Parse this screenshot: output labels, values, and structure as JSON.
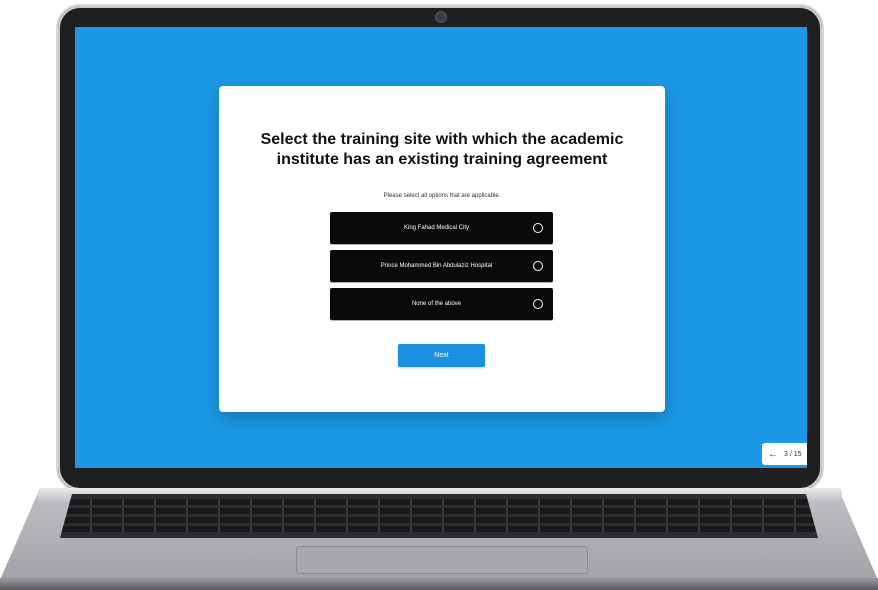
{
  "question": {
    "title": "Select the training site with which the academic institute has an existing training agreement",
    "instruction": "Please select all options that are applicable."
  },
  "options": [
    {
      "label": "King Fahad Medical City",
      "selected": false
    },
    {
      "label": "Prince Mohammed Bin Abdulaziz Hospital",
      "selected": false
    },
    {
      "label": "None of the above",
      "selected": false
    }
  ],
  "next_button": {
    "label": "Next"
  },
  "pager": {
    "arrow": "←",
    "text": "3 / 15"
  },
  "colors": {
    "screen_background": "#1b99e6",
    "option_background": "#0a0a0a",
    "button_background": "#1b8fe0"
  },
  "icons": {
    "pager_back": "arrow-left-icon",
    "option_marker": "radio-circle-icon"
  }
}
